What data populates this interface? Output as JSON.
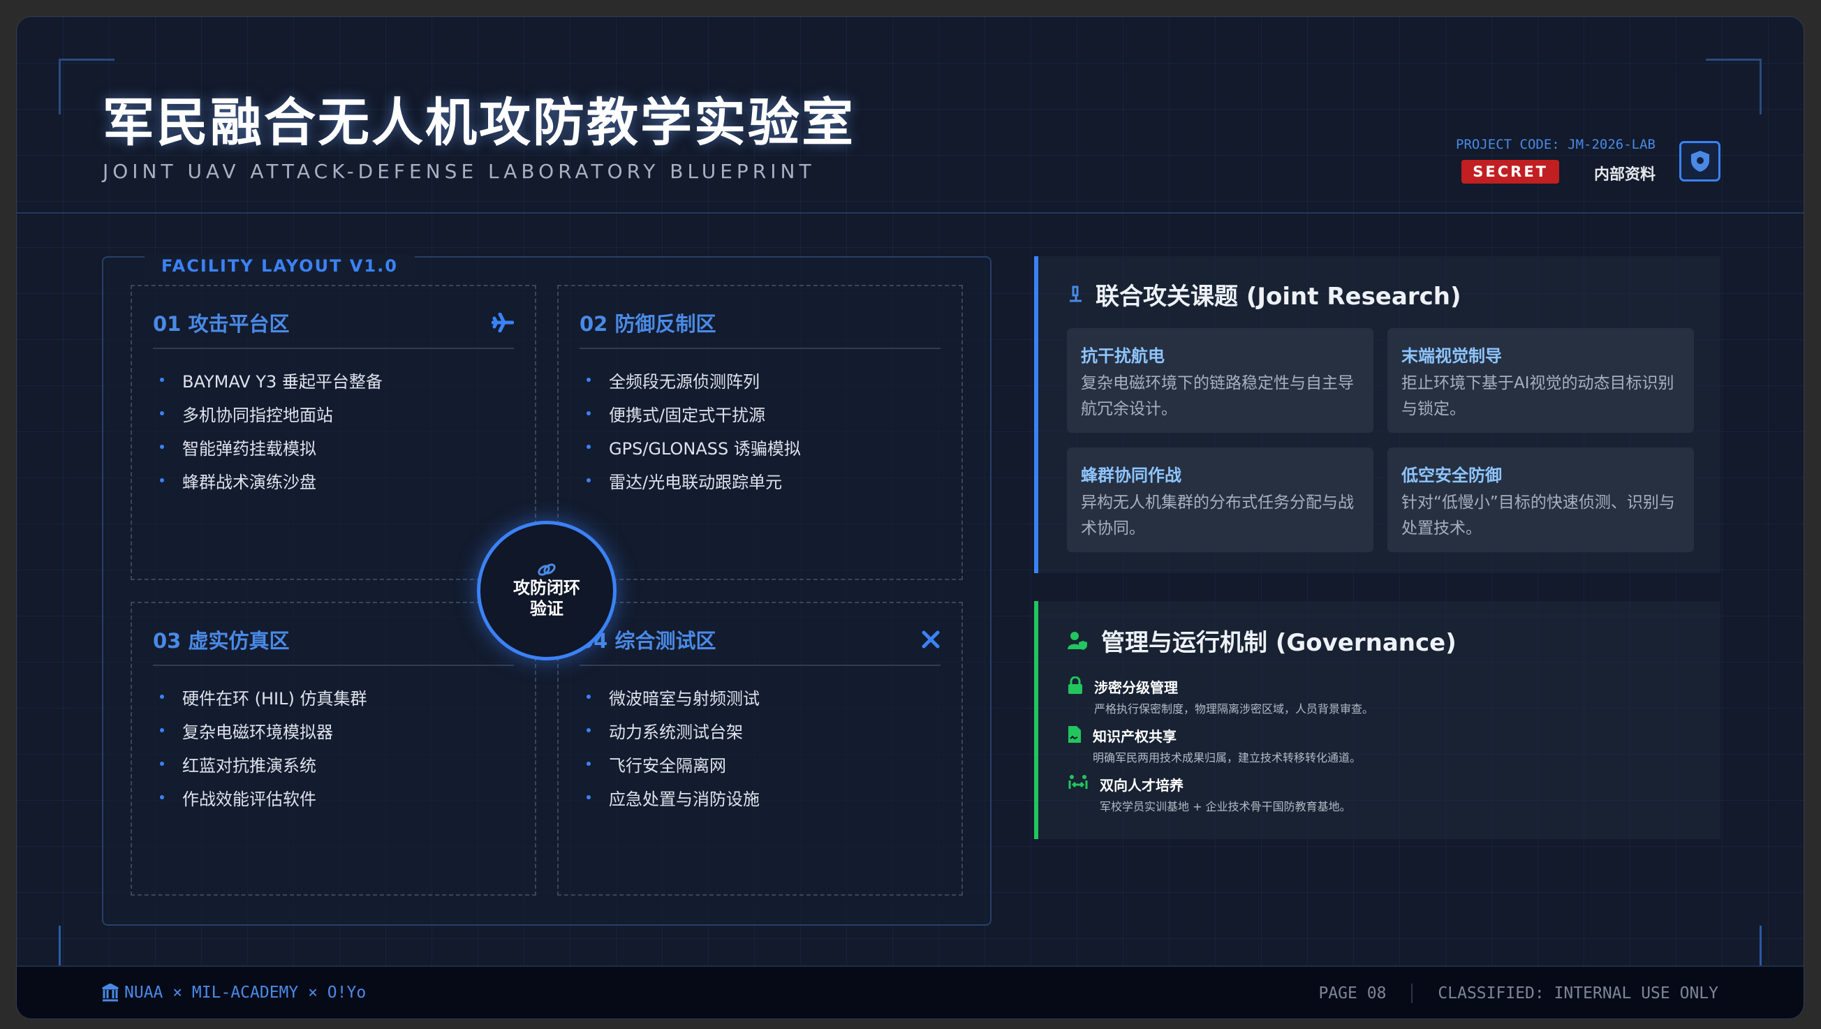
{
  "header": {
    "title": "军民融合无人机攻防教学实验室",
    "subtitle": "JOINT UAV ATTACK-DEFENSE LABORATORY BLUEPRINT",
    "project_code": "PROJECT CODE: JM-2026-LAB",
    "badge": "SECRET",
    "classification_cn": "内部资料",
    "badge_color": "#c21f22"
  },
  "facility": {
    "label": "FACILITY LAYOUT V1.0",
    "zones": [
      {
        "title": "01 攻击平台区",
        "icon": "plane-icon",
        "items": [
          "BAYMAV Y3 垂起平台整备",
          "多机协同指控地面站",
          "智能弹药挂载模拟",
          "蜂群战术演练沙盘"
        ]
      },
      {
        "title": "02 防御反制区",
        "items": [
          "全频段无源侦测阵列",
          "便携式/固定式干扰源",
          "GPS/GLONASS 诱骗模拟",
          "雷达/光电联动跟踪单元"
        ]
      },
      {
        "title": "03 虚实仿真区",
        "items": [
          "硬件在环 (HIL) 仿真集群",
          "复杂电磁环境模拟器",
          "红蓝对抗推演系统",
          "作战效能评估软件"
        ]
      },
      {
        "title": "04 综合测试区",
        "icon": "tools-icon",
        "items": [
          "微波暗室与射频测试",
          "动力系统测试台架",
          "飞行安全隔离网",
          "应急处置与消防设施"
        ]
      }
    ],
    "hub": {
      "line1": "攻防闭环",
      "line2": "验证",
      "icon": "link-icon"
    }
  },
  "research": {
    "title": "联合攻关课题 (Joint Research)",
    "accent": "#3b82f6",
    "cards": [
      {
        "title": "抗干扰航电",
        "desc": "复杂电磁环境下的链路稳定性与自主导航冗余设计。"
      },
      {
        "title": "末端视觉制导",
        "desc": "拒止环境下基于AI视觉的动态目标识别与锁定。"
      },
      {
        "title": "蜂群协同作战",
        "desc": "异构无人机集群的分布式任务分配与战术协同。"
      },
      {
        "title": "低空安全防御",
        "desc": "针对“低慢小”目标的快速侦测、识别与处置技术。"
      }
    ]
  },
  "governance": {
    "title": "管理与运行机制 (Governance)",
    "accent": "#22c55e",
    "items": [
      {
        "title": "涉密分级管理",
        "desc": "严格执行保密制度，物理隔离涉密区域，人员背景审查。"
      },
      {
        "title": "知识产权共享",
        "desc": "明确军民两用技术成果归属，建立技术转移转化通道。"
      },
      {
        "title": "双向人才培养",
        "desc": "军校学员实训基地 + 企业技术骨干国防教育基地。"
      }
    ]
  },
  "footer": {
    "orgs": "NUAA × MIL-ACADEMY × O!Yo",
    "page": "PAGE 08",
    "classified": "CLASSIFIED: INTERNAL USE ONLY"
  }
}
